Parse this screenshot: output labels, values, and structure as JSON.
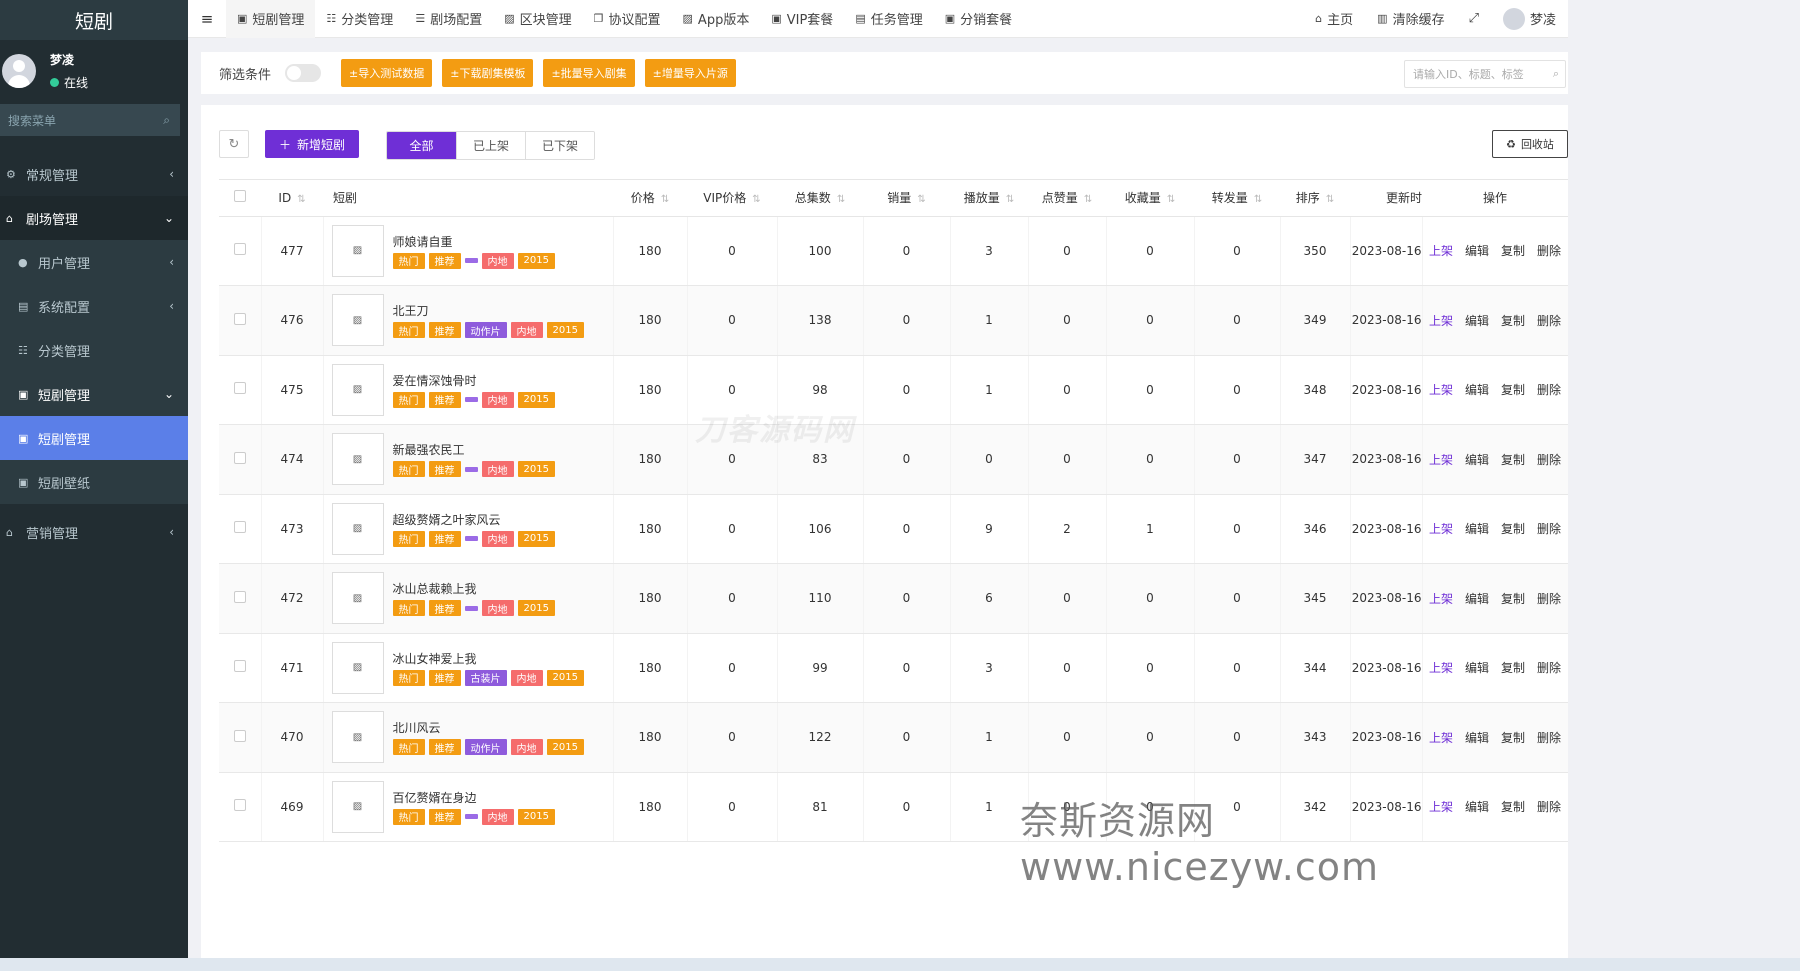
{
  "sidebar": {
    "brand": "短剧",
    "user": {
      "name": "梦凌",
      "status": "在线"
    },
    "search_placeholder": "搜索菜单",
    "menu": [
      {
        "label": "常规管理",
        "icon": "gears-icon"
      },
      {
        "label": "剧场管理",
        "icon": "home-icon"
      },
      {
        "label": "用户管理",
        "icon": "user-icon"
      },
      {
        "label": "系统配置",
        "icon": "file-icon"
      },
      {
        "label": "分类管理",
        "icon": "sitemap-icon"
      },
      {
        "label": "短剧管理",
        "icon": "briefcase-icon"
      },
      {
        "label": "短剧管理",
        "icon": "briefcase-icon"
      },
      {
        "label": "短剧壁纸",
        "icon": "briefcase-icon"
      },
      {
        "label": "营销管理",
        "icon": "home-icon"
      }
    ]
  },
  "topnav": {
    "tabs": [
      {
        "label": "短剧管理",
        "icon": "briefcase-icon"
      },
      {
        "label": "分类管理",
        "icon": "sitemap-icon"
      },
      {
        "label": "剧场配置",
        "icon": "sliders-icon"
      },
      {
        "label": "区块管理",
        "icon": "image-icon"
      },
      {
        "label": "协议配置",
        "icon": "copy-icon"
      },
      {
        "label": "App版本",
        "icon": "image-icon"
      },
      {
        "label": "VIP套餐",
        "icon": "v-icon"
      },
      {
        "label": "任务管理",
        "icon": "file-icon"
      },
      {
        "label": "分销套餐",
        "icon": "v-icon"
      }
    ],
    "home": "主页",
    "clear_cache": "清除缓存",
    "user": "梦凌"
  },
  "toolbar": {
    "filter_label": "筛选条件",
    "buttons": [
      "±导入测试数据",
      "±下载剧集模板",
      "±批量导入剧集",
      "±增量导入片源"
    ],
    "search_placeholder": "请输入ID、标题、标签"
  },
  "list": {
    "add_label": "新增短剧",
    "segments": [
      "全部",
      "已上架",
      "已下架"
    ],
    "recycle_label": "回收站"
  },
  "table": {
    "columns": [
      "ID",
      "短剧",
      "价格",
      "VIP价格",
      "总集数",
      "销量",
      "播放量",
      "点赞量",
      "收藏量",
      "转发量",
      "排序",
      "更新时",
      "操作"
    ],
    "actions": [
      "上架",
      "编辑",
      "复制",
      "删除"
    ],
    "rows": [
      {
        "id": "477",
        "title": "师娘请自重",
        "tags": [
          "热门",
          "推荐",
          "",
          "内地",
          "2015"
        ],
        "price": "180",
        "vip": "0",
        "episodes": "100",
        "sales": "0",
        "plays": "3",
        "likes": "0",
        "favs": "0",
        "shares": "0",
        "sort": "350",
        "updated": "2023-08-16"
      },
      {
        "id": "476",
        "title": "北王刀",
        "tags": [
          "热门",
          "推荐",
          "动作片",
          "内地",
          "2015"
        ],
        "price": "180",
        "vip": "0",
        "episodes": "138",
        "sales": "0",
        "plays": "1",
        "likes": "0",
        "favs": "0",
        "shares": "0",
        "sort": "349",
        "updated": "2023-08-16"
      },
      {
        "id": "475",
        "title": "爱在情深蚀骨时",
        "tags": [
          "热门",
          "推荐",
          "",
          "内地",
          "2015"
        ],
        "price": "180",
        "vip": "0",
        "episodes": "98",
        "sales": "0",
        "plays": "1",
        "likes": "0",
        "favs": "0",
        "shares": "0",
        "sort": "348",
        "updated": "2023-08-16"
      },
      {
        "id": "474",
        "title": "新最强农民工",
        "tags": [
          "热门",
          "推荐",
          "",
          "内地",
          "2015"
        ],
        "price": "180",
        "vip": "0",
        "episodes": "83",
        "sales": "0",
        "plays": "0",
        "likes": "0",
        "favs": "0",
        "shares": "0",
        "sort": "347",
        "updated": "2023-08-16"
      },
      {
        "id": "473",
        "title": "超级赘婿之叶家风云",
        "tags": [
          "热门",
          "推荐",
          "",
          "内地",
          "2015"
        ],
        "price": "180",
        "vip": "0",
        "episodes": "106",
        "sales": "0",
        "plays": "9",
        "likes": "2",
        "favs": "1",
        "shares": "0",
        "sort": "346",
        "updated": "2023-08-16"
      },
      {
        "id": "472",
        "title": "冰山总裁赖上我",
        "tags": [
          "热门",
          "推荐",
          "",
          "内地",
          "2015"
        ],
        "price": "180",
        "vip": "0",
        "episodes": "110",
        "sales": "0",
        "plays": "6",
        "likes": "0",
        "favs": "0",
        "shares": "0",
        "sort": "345",
        "updated": "2023-08-16"
      },
      {
        "id": "471",
        "title": "冰山女神爱上我",
        "tags": [
          "热门",
          "推荐",
          "古装片",
          "内地",
          "2015"
        ],
        "price": "180",
        "vip": "0",
        "episodes": "99",
        "sales": "0",
        "plays": "3",
        "likes": "0",
        "favs": "0",
        "shares": "0",
        "sort": "344",
        "updated": "2023-08-16"
      },
      {
        "id": "470",
        "title": "北川风云",
        "tags": [
          "热门",
          "推荐",
          "动作片",
          "内地",
          "2015"
        ],
        "price": "180",
        "vip": "0",
        "episodes": "122",
        "sales": "0",
        "plays": "1",
        "likes": "0",
        "favs": "0",
        "shares": "0",
        "sort": "343",
        "updated": "2023-08-16"
      },
      {
        "id": "469",
        "title": "百亿赘婿在身边",
        "tags": [
          "热门",
          "推荐",
          "",
          "内地",
          "2015"
        ],
        "price": "180",
        "vip": "0",
        "episodes": "81",
        "sales": "0",
        "plays": "1",
        "likes": "0",
        "favs": "0",
        "shares": "0",
        "sort": "342",
        "updated": "2023-08-16"
      }
    ]
  },
  "watermarks": [
    "刀客源码网",
    "奈斯资源网www.nicezyw.com"
  ],
  "colors": {
    "sidebar": "#222d32",
    "active": "#5b7fe8",
    "primary": "#6f2fd6",
    "warning": "#f39c12",
    "danger": "#f56c6c"
  }
}
